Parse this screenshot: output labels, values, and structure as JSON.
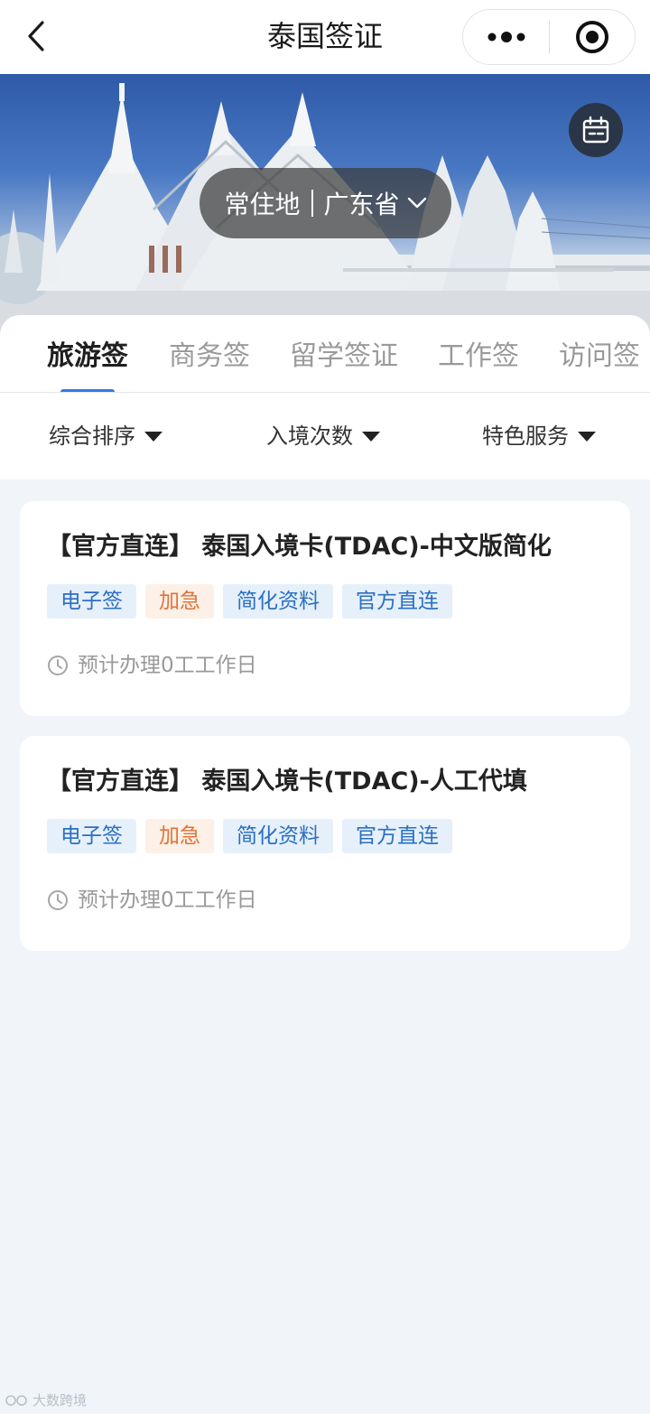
{
  "header": {
    "title": "泰国签证"
  },
  "hero": {
    "location_label": "常住地",
    "location_value": "广东省"
  },
  "tabs": [
    {
      "label": "旅游签",
      "active": true
    },
    {
      "label": "商务签",
      "active": false
    },
    {
      "label": "留学签证",
      "active": false
    },
    {
      "label": "工作签",
      "active": false
    },
    {
      "label": "访问签",
      "active": false
    }
  ],
  "filters": [
    {
      "label": "综合排序"
    },
    {
      "label": "入境次数"
    },
    {
      "label": "特色服务"
    }
  ],
  "products": [
    {
      "title": "【官方直连】 泰国入境卡(TDAC)-中文版简化",
      "tags": [
        "电子签",
        "加急",
        "简化资料",
        "官方直连"
      ],
      "eta": "预计办理0工工作日"
    },
    {
      "title": "【官方直连】 泰国入境卡(TDAC)-人工代填",
      "tags": [
        "电子签",
        "加急",
        "简化资料",
        "官方直连"
      ],
      "eta": "预计办理0工工作日"
    }
  ],
  "watermark": {
    "text": "大数跨境"
  },
  "colors": {
    "accent": "#2f7be6",
    "tag_blue_bg": "#e6f0fb",
    "tag_blue_text": "#2b6fc2",
    "tag_orange_bg": "#fdf0e6",
    "tag_orange_text": "#e0733a",
    "page_bg": "#f1f5f9"
  },
  "icons": [
    "back-icon",
    "more-dots-icon",
    "close-target-icon",
    "calendar-icon",
    "chevron-down-icon",
    "clock-icon"
  ]
}
